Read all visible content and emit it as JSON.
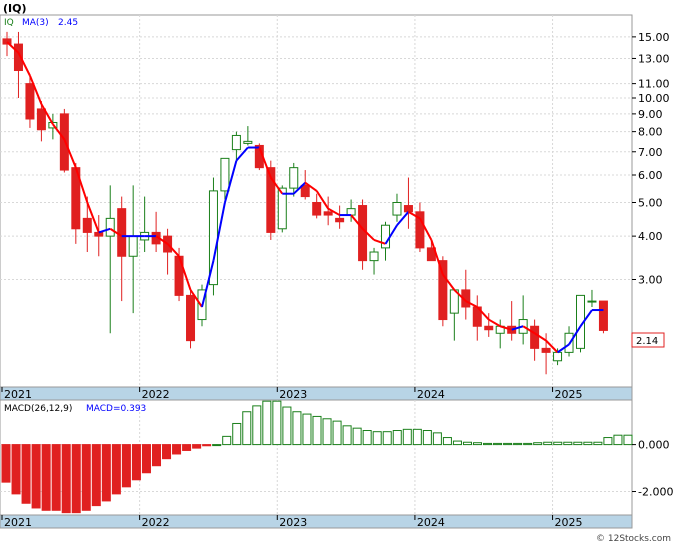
{
  "header": {
    "symbol": "(IQ)"
  },
  "legend": {
    "ticker": "IQ",
    "ma_label": "MA(3)",
    "ma_value": "2.45"
  },
  "price_label": "2.14",
  "macd": {
    "label": "MACD(26,12,9)",
    "value_label": "MACD=0.393"
  },
  "watermark": "© 12Stocks.com",
  "years": [
    "2021",
    "2022",
    "2023",
    "2024",
    "2025"
  ],
  "chart_data": [
    {
      "type": "candlestick",
      "scale": "log",
      "y_ticks": [
        15,
        13,
        11,
        10,
        9,
        8,
        7,
        6,
        5,
        4,
        3
      ],
      "y_tick_labels": [
        "15.00",
        "13.00",
        "11.00",
        "10.00",
        "9.00",
        "8.00",
        "7.00",
        "6.00",
        "5.00",
        "4.00",
        "3.00"
      ],
      "ylim": [
        1.5,
        17.0
      ],
      "period": "monthly",
      "start": "2021-01",
      "candles": [
        [
          14.8,
          15.5,
          13.2,
          14.3
        ],
        [
          14.3,
          15.5,
          10.0,
          12.0
        ],
        [
          11.0,
          11.5,
          8.2,
          8.7
        ],
        [
          9.3,
          9.8,
          7.5,
          8.1
        ],
        [
          8.2,
          9.0,
          7.6,
          8.5
        ],
        [
          9.0,
          9.3,
          6.1,
          6.2
        ],
        [
          6.3,
          6.5,
          3.8,
          4.2
        ],
        [
          4.5,
          5.2,
          3.6,
          4.1
        ],
        [
          4.1,
          4.6,
          3.5,
          4.0
        ],
        [
          4.0,
          5.6,
          2.1,
          4.5
        ],
        [
          4.8,
          5.2,
          2.6,
          3.5
        ],
        [
          3.5,
          5.6,
          2.4,
          4.0
        ],
        [
          3.9,
          5.2,
          3.6,
          4.1
        ],
        [
          4.1,
          4.7,
          3.6,
          3.8
        ],
        [
          4.0,
          4.2,
          3.1,
          3.6
        ],
        [
          3.5,
          3.7,
          2.6,
          2.7
        ],
        [
          2.7,
          2.8,
          1.9,
          2.0
        ],
        [
          2.3,
          2.9,
          2.2,
          2.8
        ],
        [
          2.9,
          5.9,
          2.7,
          5.4
        ],
        [
          5.4,
          6.7,
          5.1,
          6.7
        ],
        [
          7.1,
          8.0,
          6.6,
          7.8
        ],
        [
          7.4,
          8.3,
          7.3,
          7.5
        ],
        [
          7.3,
          7.4,
          6.2,
          6.3
        ],
        [
          6.3,
          6.6,
          3.9,
          4.1
        ],
        [
          4.2,
          5.6,
          4.1,
          5.5
        ],
        [
          5.5,
          6.5,
          5.2,
          6.3
        ],
        [
          5.6,
          6.2,
          5.1,
          5.2
        ],
        [
          5.0,
          5.3,
          4.5,
          4.6
        ],
        [
          4.7,
          5.2,
          4.3,
          4.6
        ],
        [
          4.5,
          4.9,
          4.2,
          4.4
        ],
        [
          4.6,
          5.1,
          4.4,
          4.8
        ],
        [
          4.9,
          5.1,
          3.2,
          3.4
        ],
        [
          3.4,
          3.7,
          3.1,
          3.6
        ],
        [
          3.7,
          4.4,
          3.4,
          4.3
        ],
        [
          4.6,
          5.3,
          4.4,
          5.0
        ],
        [
          4.9,
          5.9,
          4.2,
          4.7
        ],
        [
          4.7,
          5.0,
          3.6,
          3.7
        ],
        [
          3.7,
          3.9,
          3.4,
          3.4
        ],
        [
          3.4,
          3.5,
          2.2,
          2.3
        ],
        [
          2.4,
          2.8,
          2.0,
          2.8
        ],
        [
          2.8,
          3.2,
          2.3,
          2.5
        ],
        [
          2.5,
          2.7,
          2.0,
          2.2
        ],
        [
          2.2,
          2.4,
          2.05,
          2.15
        ],
        [
          2.1,
          2.3,
          1.9,
          2.2
        ],
        [
          2.2,
          2.6,
          2.0,
          2.1
        ],
        [
          2.1,
          2.7,
          1.95,
          2.3
        ],
        [
          2.2,
          2.3,
          1.75,
          1.9
        ],
        [
          1.9,
          2.1,
          1.6,
          1.85
        ],
        [
          1.75,
          1.9,
          1.7,
          1.85
        ],
        [
          1.85,
          2.2,
          1.8,
          2.1
        ],
        [
          1.9,
          2.7,
          1.85,
          2.7
        ],
        [
          2.6,
          2.8,
          2.5,
          2.6
        ],
        [
          2.6,
          2.6,
          2.1,
          2.14
        ]
      ],
      "ma": [
        14.5,
        13.5,
        11.6,
        9.6,
        8.4,
        7.6,
        6.3,
        5.0,
        4.1,
        4.2,
        4.0,
        4.0,
        4.0,
        4.0,
        3.8,
        3.5,
        2.8,
        2.5,
        3.4,
        5.0,
        6.6,
        7.2,
        7.2,
        5.9,
        5.3,
        5.3,
        5.7,
        5.4,
        4.8,
        4.6,
        4.6,
        4.2,
        3.9,
        3.8,
        4.3,
        4.7,
        4.5,
        3.9,
        3.1,
        2.8,
        2.6,
        2.5,
        2.3,
        2.2,
        2.15,
        2.2,
        2.1,
        2.0,
        1.85,
        1.95,
        2.2,
        2.45,
        2.45
      ]
    },
    {
      "type": "bar",
      "title": "MACD(26,12,9)",
      "y_ticks": [
        0,
        -2
      ],
      "y_tick_labels": [
        "0.000",
        "-2.000"
      ],
      "ylim": [
        -3.0,
        1.9
      ],
      "values": [
        -1.6,
        -2.1,
        -2.5,
        -2.7,
        -2.8,
        -2.8,
        -2.9,
        -2.9,
        -2.8,
        -2.6,
        -2.4,
        -2.1,
        -1.8,
        -1.5,
        -1.2,
        -0.9,
        -0.6,
        -0.4,
        -0.25,
        -0.15,
        -0.05,
        0.0,
        0.35,
        0.9,
        1.4,
        1.65,
        1.85,
        1.85,
        1.6,
        1.4,
        1.3,
        1.2,
        1.1,
        1.0,
        0.8,
        0.7,
        0.6,
        0.55,
        0.55,
        0.6,
        0.65,
        0.65,
        0.6,
        0.5,
        0.3,
        0.15,
        0.1,
        0.08,
        0.05,
        0.05,
        0.05,
        0.05,
        0.05,
        0.08,
        0.1,
        0.1,
        0.1,
        0.1,
        0.1,
        0.1,
        0.3,
        0.4,
        0.4
      ]
    }
  ],
  "colors": {
    "up": "#1a7f1a",
    "down": "#e02020",
    "ma_up": "#0000ff",
    "ma_down": "#ff0000",
    "macd_pos": "#1a7f1a",
    "macd_neg": "#e02020",
    "axis_band": "#b8d4e6",
    "grid": "#d8d8d8"
  }
}
